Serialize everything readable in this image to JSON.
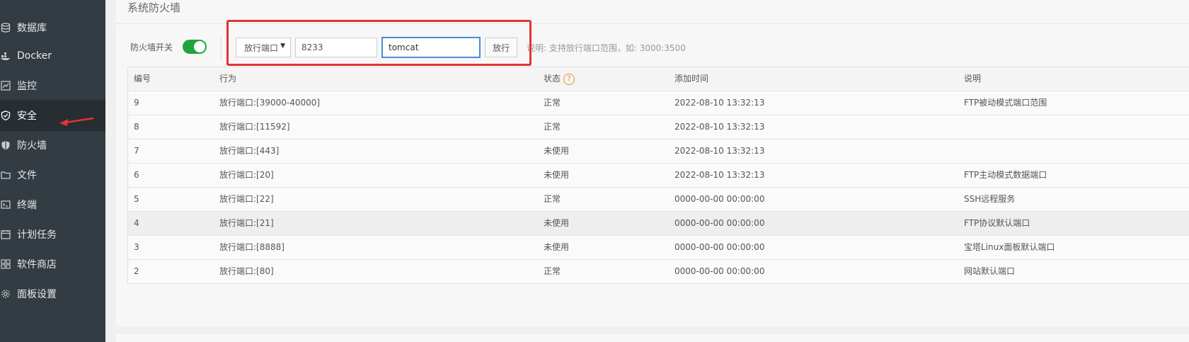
{
  "sidebar": {
    "items": [
      {
        "label": "数据库",
        "icon": "database-icon"
      },
      {
        "label": "Docker",
        "icon": "docker-icon"
      },
      {
        "label": "监控",
        "icon": "monitor-icon"
      },
      {
        "label": "安全",
        "icon": "shield-icon",
        "active": true
      },
      {
        "label": "防火墙",
        "icon": "firewall-icon"
      },
      {
        "label": "文件",
        "icon": "folder-icon"
      },
      {
        "label": "终端",
        "icon": "terminal-icon"
      },
      {
        "label": "计划任务",
        "icon": "calendar-icon"
      },
      {
        "label": "软件商店",
        "icon": "apps-icon"
      },
      {
        "label": "面板设置",
        "icon": "gear-icon"
      }
    ]
  },
  "panel": {
    "title": "系统防火墙"
  },
  "toolbar": {
    "firewall_switch_label": "防火墙开关",
    "firewall_enabled": true,
    "rule_type_selected": "放行端口",
    "port_value": "8233",
    "description_value": "tomcat",
    "allow_button": "放行",
    "hint": "说明: 支持放行端口范围，如: 3000:3500"
  },
  "table": {
    "headers": [
      "编号",
      "行为",
      "状态",
      "添加时间",
      "说明"
    ],
    "rows": [
      {
        "id": "9",
        "action": "放行端口:[39000-40000]",
        "status": "正常",
        "time": "2022-08-10 13:32:13",
        "note": "FTP被动模式端口范围"
      },
      {
        "id": "8",
        "action": "放行端口:[11592]",
        "status": "正常",
        "time": "2022-08-10 13:32:13",
        "note": ""
      },
      {
        "id": "7",
        "action": "放行端口:[443]",
        "status": "未使用",
        "time": "2022-08-10 13:32:13",
        "note": ""
      },
      {
        "id": "6",
        "action": "放行端口:[20]",
        "status": "未使用",
        "time": "2022-08-10 13:32:13",
        "note": "FTP主动模式数据端口"
      },
      {
        "id": "5",
        "action": "放行端口:[22]",
        "status": "正常",
        "time": "0000-00-00 00:00:00",
        "note": "SSH远程服务"
      },
      {
        "id": "4",
        "action": "放行端口:[21]",
        "status": "未使用",
        "time": "0000-00-00 00:00:00",
        "note": "FTP协议默认端口"
      },
      {
        "id": "3",
        "action": "放行端口:[8888]",
        "status": "未使用",
        "time": "0000-00-00 00:00:00",
        "note": "宝塔Linux面板默认端口"
      },
      {
        "id": "2",
        "action": "放行端口:[80]",
        "status": "正常",
        "time": "0000-00-00 00:00:00",
        "note": "网站默认端口"
      }
    ]
  },
  "colors": {
    "sidebar_bg": "#333c42",
    "accent_green": "#20a53a",
    "highlight_red": "#e53333",
    "focus_blue": "#4a8bd6"
  }
}
